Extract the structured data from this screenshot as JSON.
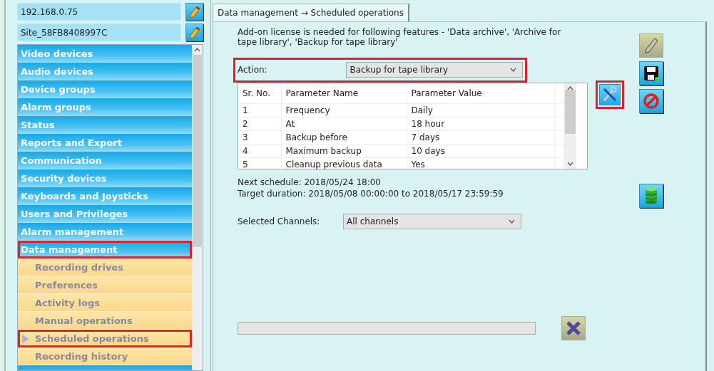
{
  "site_fields": [
    {
      "value": "192.168.0.75"
    },
    {
      "value": "Site_58FB8408997C"
    }
  ],
  "sidebar": {
    "items": [
      {
        "label": "Video devices",
        "highlighted": false
      },
      {
        "label": "Audio devices",
        "highlighted": false
      },
      {
        "label": "Device groups",
        "highlighted": false
      },
      {
        "label": "Alarm groups",
        "highlighted": false
      },
      {
        "label": "Status",
        "highlighted": false
      },
      {
        "label": "Reports and Export",
        "highlighted": false
      },
      {
        "label": "Communication",
        "highlighted": false
      },
      {
        "label": "Security devices",
        "highlighted": false
      },
      {
        "label": "Keyboards and Joysticks",
        "highlighted": false
      },
      {
        "label": "Users and Privileges",
        "highlighted": false
      },
      {
        "label": "Alarm management",
        "highlighted": false
      },
      {
        "label": "Data management",
        "highlighted": true,
        "children": [
          {
            "label": "Recording drives",
            "selected": false,
            "highlighted": false
          },
          {
            "label": "Preferences",
            "selected": false,
            "highlighted": false
          },
          {
            "label": "Activity logs",
            "selected": false,
            "highlighted": false
          },
          {
            "label": "Manual operations",
            "selected": false,
            "highlighted": false
          },
          {
            "label": "Scheduled operations",
            "selected": true,
            "highlighted": true
          },
          {
            "label": "Recording history",
            "selected": false,
            "highlighted": false
          }
        ]
      }
    ]
  },
  "tab": {
    "label": "Data management → Scheduled operations"
  },
  "license_note": "Add-on license is needed for following features - 'Data archive', 'Archive for tape library', 'Backup for tape library'",
  "action": {
    "label": "Action:",
    "value": "Backup for tape library",
    "highlighted": true
  },
  "table": {
    "columns": [
      "Sr. No.",
      "Parameter Name",
      "Parameter Value"
    ],
    "rows": [
      [
        "1",
        "Frequency",
        "Daily"
      ],
      [
        "2",
        "At",
        "18 hour"
      ],
      [
        "3",
        "Backup before",
        "7 days"
      ],
      [
        "4",
        "Maximum backup",
        "10 days"
      ],
      [
        "5",
        "Cleanup previous data",
        "Yes"
      ]
    ]
  },
  "tools": [
    {
      "kind": "wrench",
      "disabled": false,
      "highlighted": true
    },
    {
      "kind": "pencil",
      "disabled": true,
      "highlighted": false
    },
    {
      "kind": "save",
      "disabled": false,
      "highlighted": false
    },
    {
      "kind": "cancel",
      "disabled": false,
      "highlighted": false
    }
  ],
  "next_schedule": "Next schedule: 2018/05/24 18:00",
  "target_duration": "Target duration: 2018/05/08 00:00:00 to 2018/05/17 23:59:59",
  "channels": {
    "label": "Selected Channels:",
    "value": "All channels"
  },
  "stop_button": {
    "disabled": true
  }
}
